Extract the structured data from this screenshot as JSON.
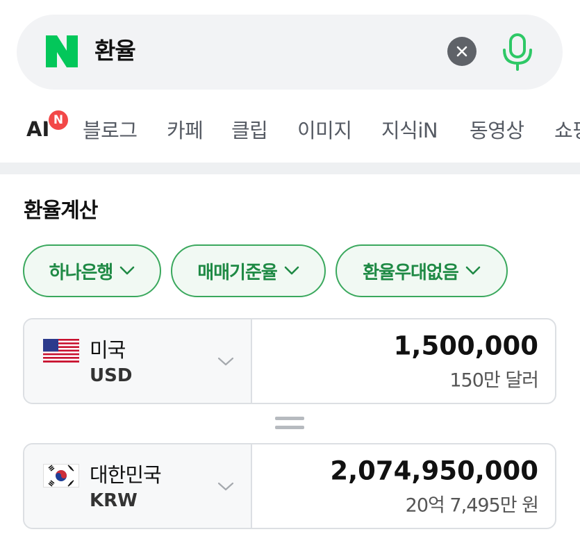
{
  "search": {
    "query": "환율"
  },
  "tabs": {
    "ai_label": "AI",
    "ai_badge": "N",
    "items": [
      "블로그",
      "카페",
      "클립",
      "이미지",
      "지식iN",
      "동영상",
      "쇼핑"
    ]
  },
  "converter": {
    "title": "환율계산",
    "filters": [
      "하나은행",
      "매매기준율",
      "환율우대없음"
    ],
    "from": {
      "name": "미국",
      "code": "USD",
      "amount": "1,500,000",
      "amount_text": "150만 달러"
    },
    "to": {
      "name": "대한민국",
      "code": "KRW",
      "amount": "2,074,950,000",
      "amount_text": "20억 7,495만 원"
    }
  },
  "colors": {
    "brand_green": "#03c75a",
    "chip_green": "#1f8a45",
    "badge_red": "#f24848"
  }
}
